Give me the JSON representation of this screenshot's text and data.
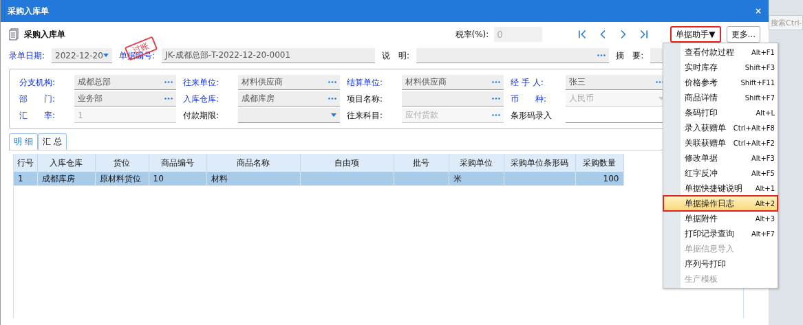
{
  "window": {
    "title": "采购入库单",
    "close": "×"
  },
  "form_title": "采购入库单",
  "stamp": "过账",
  "tax_rate": {
    "label": "税率(%):",
    "value": "0",
    "disabled": true
  },
  "assistant_button": {
    "label": "单据助手▼",
    "annotated": true
  },
  "more_button": {
    "label": "更多..."
  },
  "background_search": {
    "placeholder": "搜索Ctrl-"
  },
  "header_fields": [
    {
      "label": "录单日期:",
      "required": true,
      "value": "2022-12-20",
      "kind": "dropdown"
    },
    {
      "label": "单据编号:",
      "required": true,
      "value": "JK-成都总部-T-2022-12-20-0001",
      "kind": "plain"
    },
    {
      "label": "说　明:",
      "required": false,
      "kind": "dots"
    },
    {
      "label": "摘　要:",
      "required": false,
      "kind": "plain"
    }
  ],
  "fields": [
    {
      "label": "分支机构:",
      "required": true,
      "value": "成都总部",
      "kind": "dots",
      "disabled": false
    },
    {
      "label": "往来单位:",
      "required": true,
      "value": "材料供应商",
      "kind": "dots",
      "disabled": false
    },
    {
      "label": "结算单位:",
      "required": true,
      "value": "材料供应商",
      "kind": "dots",
      "disabled": false
    },
    {
      "label": "经 手 人:",
      "required": true,
      "value": "张三",
      "kind": "dots",
      "disabled": false
    },
    {
      "label": "部　　门:",
      "required": true,
      "value": "业务部",
      "kind": "dots",
      "disabled": false
    },
    {
      "label": "入库仓库:",
      "required": true,
      "value": "成都库房",
      "kind": "dots",
      "disabled": false
    },
    {
      "label": "项目名称:",
      "required": false,
      "kind": "dots",
      "disabled": false
    },
    {
      "label": "币　　种:",
      "required": true,
      "value": "人民币",
      "kind": "dropdown",
      "disabled": true
    },
    {
      "label": "汇　　率:",
      "required": true,
      "value": "1",
      "kind": "plain",
      "disabled": true
    },
    {
      "label": "付款期限:",
      "required": false,
      "kind": "dropdown",
      "disabled": false
    },
    {
      "label": "往来科目:",
      "required": false,
      "value": "应付货款",
      "kind": "dots",
      "disabled": true
    },
    {
      "label": "条形码录入",
      "required": false,
      "kind": "line",
      "disabled": false
    }
  ],
  "tabs": [
    {
      "label": "明 细",
      "selected": true
    },
    {
      "label": "汇 总",
      "selected": false
    }
  ],
  "table": {
    "columns": [
      "行号",
      "入库仓库",
      "货位",
      "商品编号",
      "商品名称",
      "自由项",
      "批号",
      "采购单位",
      "采购单位条形码",
      "采购数量"
    ],
    "rows": [
      {
        "selected": true,
        "cells": [
          "1",
          "成都库房",
          "原材料货位",
          "10",
          "材料",
          "",
          "",
          "米",
          "",
          "100"
        ]
      }
    ]
  },
  "menu": [
    {
      "label": "查看付款过程",
      "shortcut": "Alt+F1",
      "disabled": false,
      "selected": false,
      "annotated": false
    },
    {
      "label": "实时库存",
      "shortcut": "Shift+F3",
      "disabled": false,
      "selected": false,
      "annotated": false
    },
    {
      "label": "价格参考",
      "shortcut": "Shift+F11",
      "disabled": false,
      "selected": false,
      "annotated": false
    },
    {
      "label": "商品详情",
      "shortcut": "Shift+F7",
      "disabled": false,
      "selected": false,
      "annotated": false
    },
    {
      "label": "条码打印",
      "shortcut": "Alt+L",
      "disabled": false,
      "selected": false,
      "annotated": false
    },
    {
      "label": "录入获赠单",
      "shortcut": "Ctrl+Alt+F8",
      "disabled": false,
      "selected": false,
      "annotated": false
    },
    {
      "label": "关联获赠单",
      "shortcut": "Ctrl+Alt+F2",
      "disabled": false,
      "selected": false,
      "annotated": false
    },
    {
      "label": "修改单据",
      "shortcut": "Alt+F3",
      "disabled": false,
      "selected": false,
      "annotated": false
    },
    {
      "label": "红字反冲",
      "shortcut": "Alt+F5",
      "disabled": false,
      "selected": false,
      "annotated": false
    },
    {
      "label": "单据快捷键说明",
      "shortcut": "Alt+1",
      "disabled": false,
      "selected": false,
      "annotated": false
    },
    {
      "label": "单据操作日志",
      "shortcut": "Alt+2",
      "disabled": false,
      "selected": true,
      "annotated": true
    },
    {
      "label": "单据附件",
      "shortcut": "Alt+3",
      "disabled": false,
      "selected": false,
      "annotated": false
    },
    {
      "label": "打印记录查询",
      "shortcut": "Alt+F7",
      "disabled": false,
      "selected": false,
      "annotated": false
    },
    {
      "label": "单据信息导入",
      "disabled": true,
      "selected": false,
      "annotated": false
    },
    {
      "label": "序列号打印",
      "disabled": false,
      "selected": false,
      "annotated": false
    },
    {
      "label": "生产模板",
      "disabled": true,
      "selected": false,
      "annotated": false
    }
  ]
}
